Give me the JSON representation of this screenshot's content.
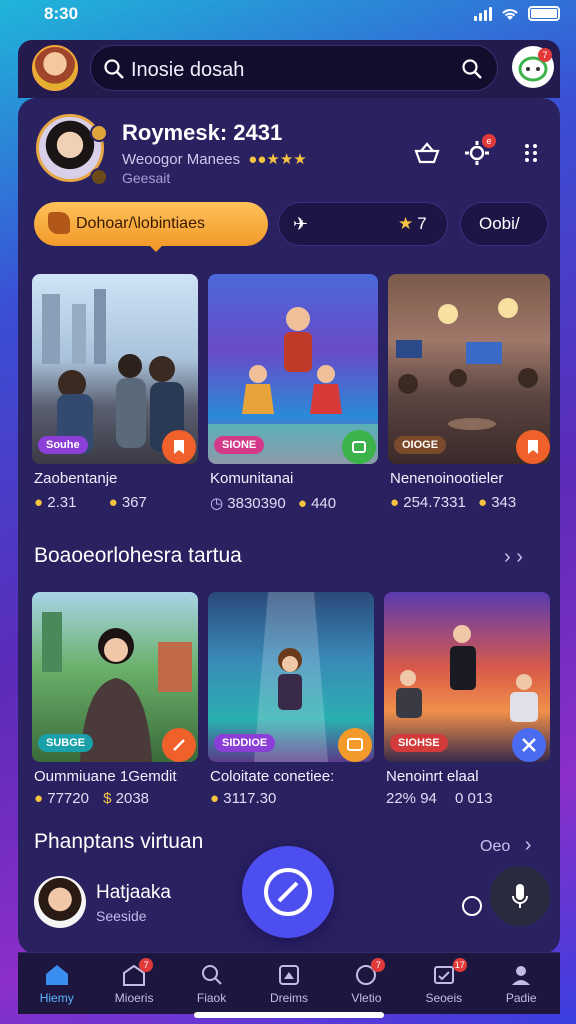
{
  "status_bar": {
    "time": "8:30"
  },
  "search": {
    "placeholder": "Inosie dosah"
  },
  "chat": {
    "badge": "7"
  },
  "profile": {
    "name": "Roymesk: 2431",
    "subtitle": "Weoogor Manees",
    "status": "Geesait"
  },
  "header_actions": {
    "notifications_badge": "e"
  },
  "filters": {
    "primary_label": "Dohoar/\\lobintiaes",
    "chip2_label": "",
    "chip3_label": "7",
    "chip4_label": "Oobi/"
  },
  "featured": [
    {
      "tag": "Souhe",
      "title": "Zaobentanje",
      "stat1": "2.31",
      "stat2": "367",
      "tag_color": "#8b3fd6",
      "action_color": "#f0602a"
    },
    {
      "tag": "SIONE",
      "title": "Komunitanai",
      "stat1": "3830390",
      "stat2": "440",
      "tag_color": "#d33a8a",
      "action_color": "#3bb34a"
    },
    {
      "tag": "OIOGE",
      "title": "Nenenoinootieler",
      "stat1": "254.7331",
      "stat2": "343",
      "tag_color": "#7a4a2a",
      "action_color": "#f0602a"
    }
  ],
  "section1": {
    "title": "Boaoeorlohesra tartua"
  },
  "second_row": [
    {
      "tag": "SUBGE",
      "title": "Oummiuane 1Gemdit",
      "stat1": "77720",
      "stat2": "2038",
      "tag_color": "#1aa0a8",
      "action_color": "#f0602a"
    },
    {
      "tag": "SIDDIOE",
      "title": "Coloitate conetiee:",
      "stat1": "3117.30",
      "stat2": "",
      "tag_color": "#8b3fd6",
      "action_color": "#f39a2a"
    },
    {
      "tag": "SIOHSE",
      "title": "Nenoinrt elaal",
      "stat1": "22% 94",
      "stat2": "0 013",
      "tag_color": "#d33a3a",
      "action_color": "#4b6cf0"
    }
  ],
  "section2": {
    "title": "Phanptans virtuan",
    "link": "Oeo"
  },
  "person": {
    "name": "Hatjaaka",
    "subtitle": "Seeside"
  },
  "nav": [
    {
      "label": "Hiemy",
      "badge": ""
    },
    {
      "label": "Mioeris",
      "badge": "7"
    },
    {
      "label": "Fiaok",
      "badge": ""
    },
    {
      "label": "Dreims",
      "badge": ""
    },
    {
      "label": "Vletio",
      "badge": "7"
    },
    {
      "label": "Seoeis",
      "badge": "17"
    },
    {
      "label": "Padie",
      "badge": ""
    }
  ],
  "colors": {
    "accent": "#4c4ef0",
    "panel": "#2a2160",
    "pill": "#f29a2a"
  }
}
